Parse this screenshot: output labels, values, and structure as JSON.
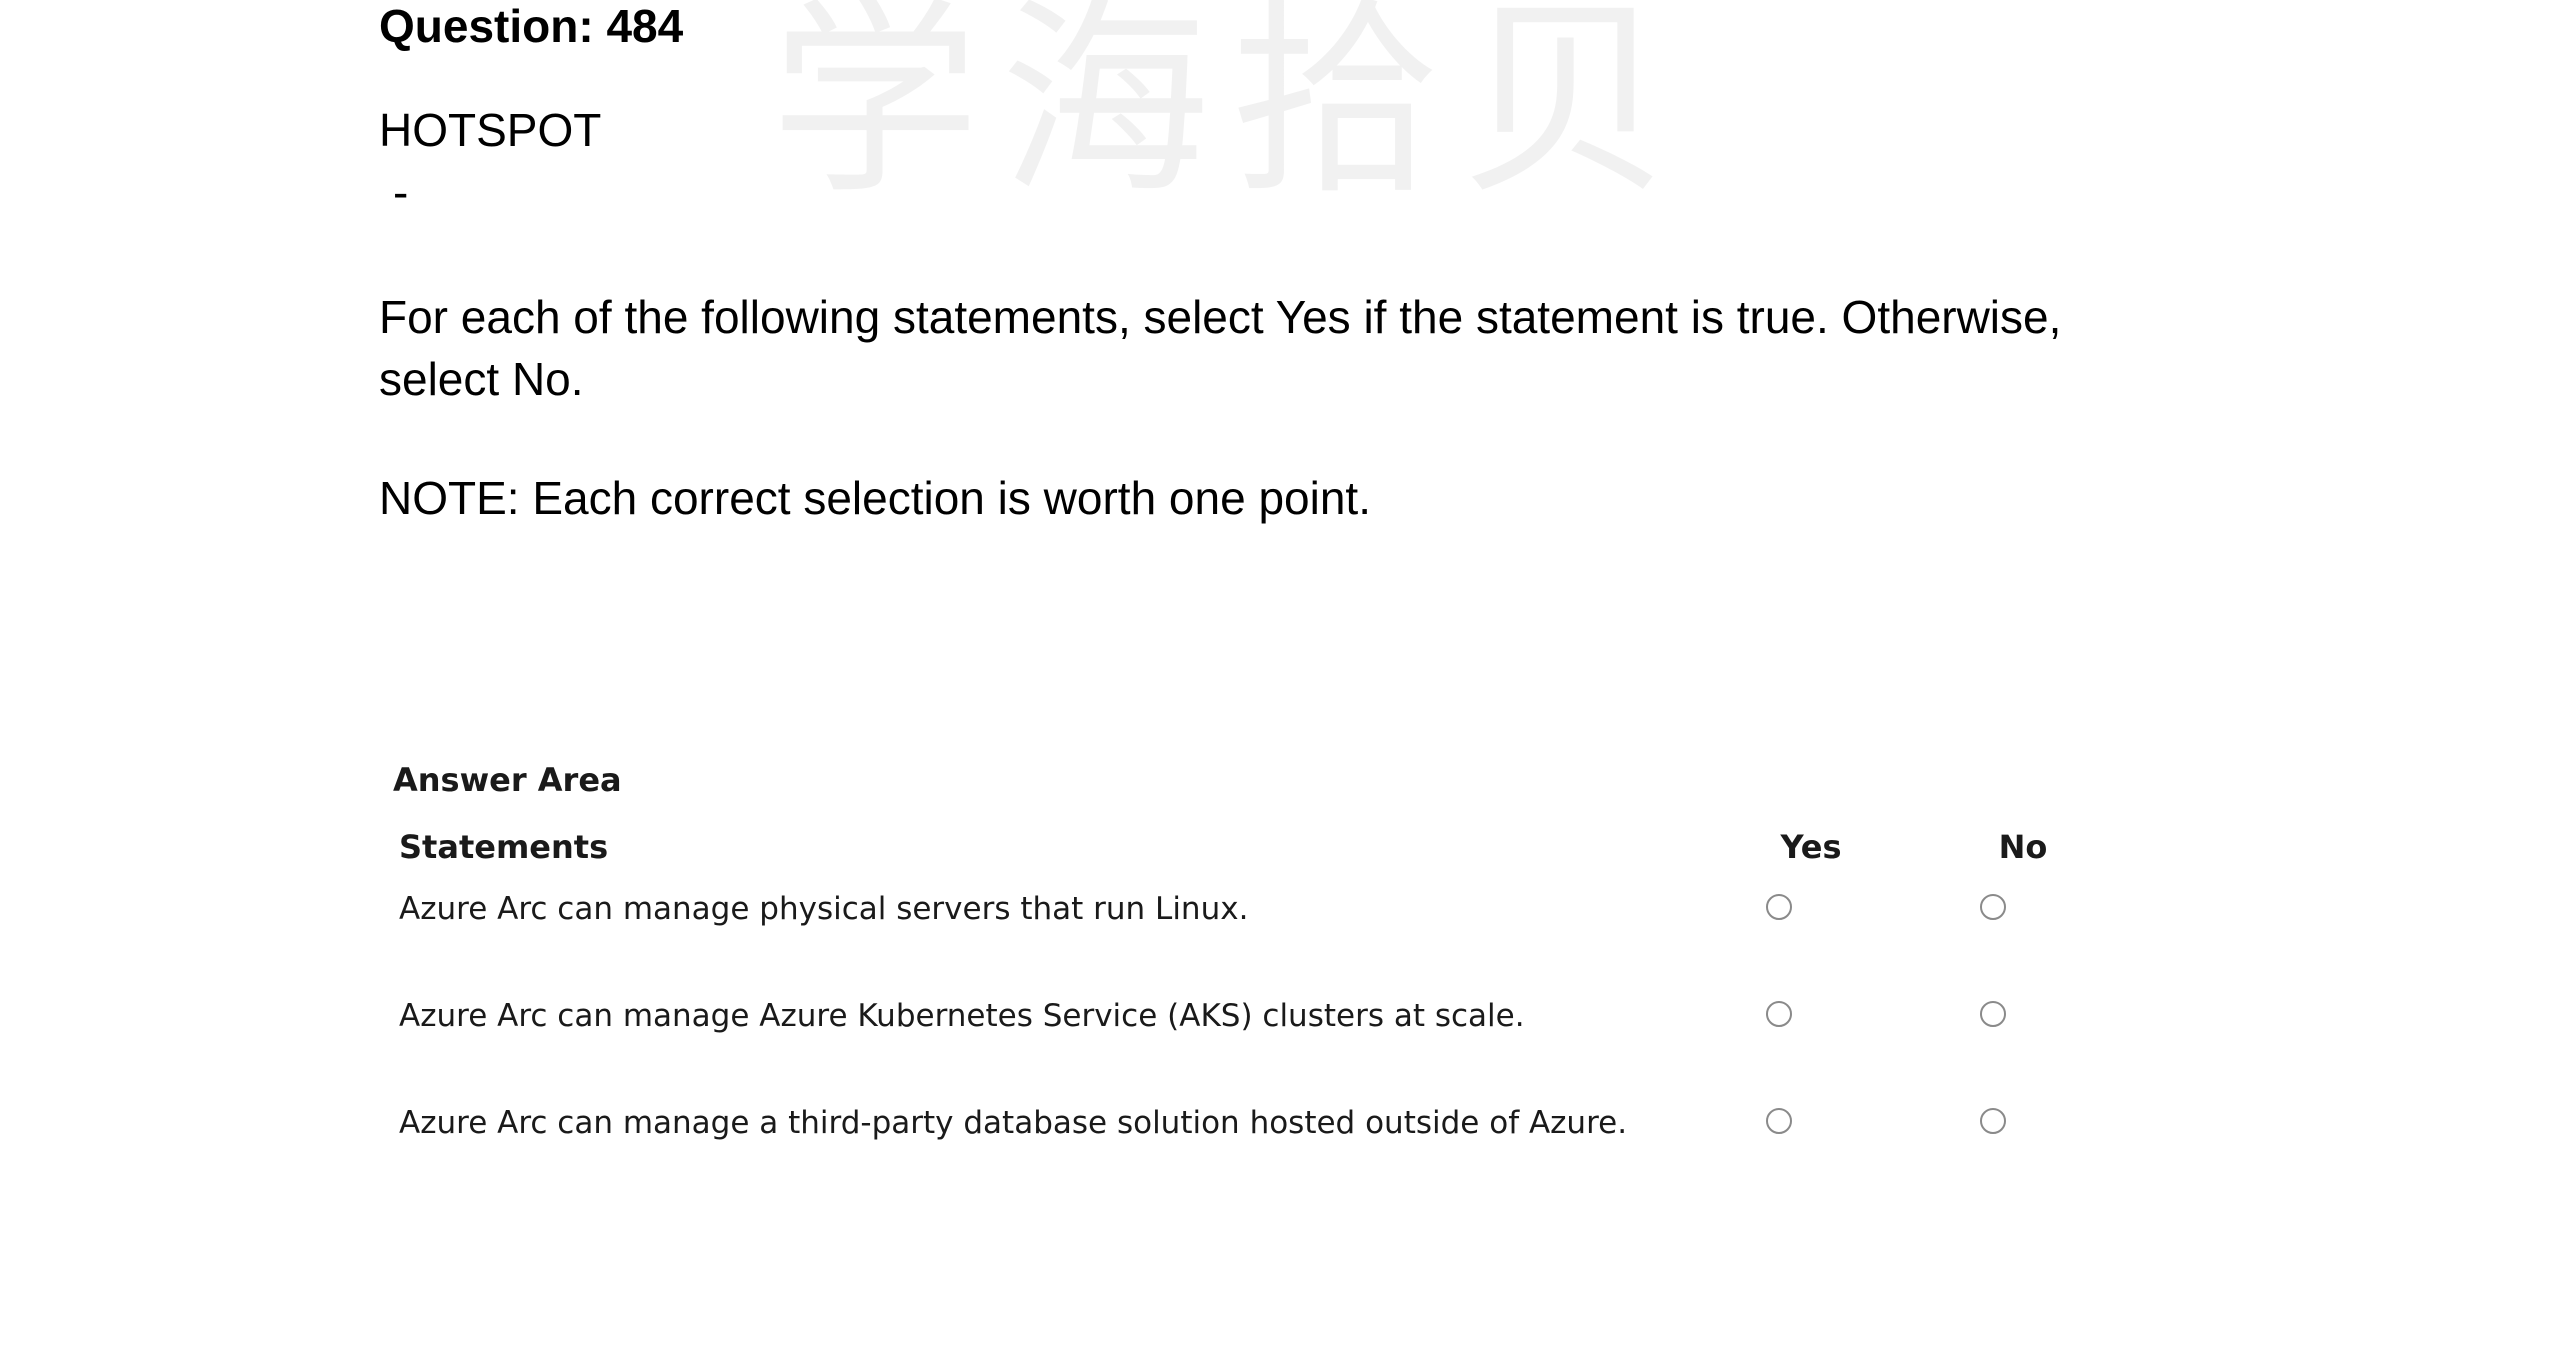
{
  "watermark": {
    "text": "学海拾贝"
  },
  "question": {
    "title": "Question: 484",
    "type": "HOTSPOT",
    "dash": "-",
    "instructions": "For each of the following statements, select Yes if the statement is true. Otherwise, select No.",
    "note": "NOTE: Each correct selection is worth one point."
  },
  "answer_area": {
    "title": "Answer Area",
    "headers": {
      "statements": "Statements",
      "yes": "Yes",
      "no": "No"
    },
    "rows": [
      {
        "statement": "Azure Arc can manage physical servers that run Linux.",
        "selected": null
      },
      {
        "statement": "Azure Arc can manage Azure Kubernetes Service (AKS) clusters at scale.",
        "selected": null
      },
      {
        "statement": "Azure Arc can manage a third-party database solution hosted outside of Azure.",
        "selected": null
      }
    ]
  }
}
